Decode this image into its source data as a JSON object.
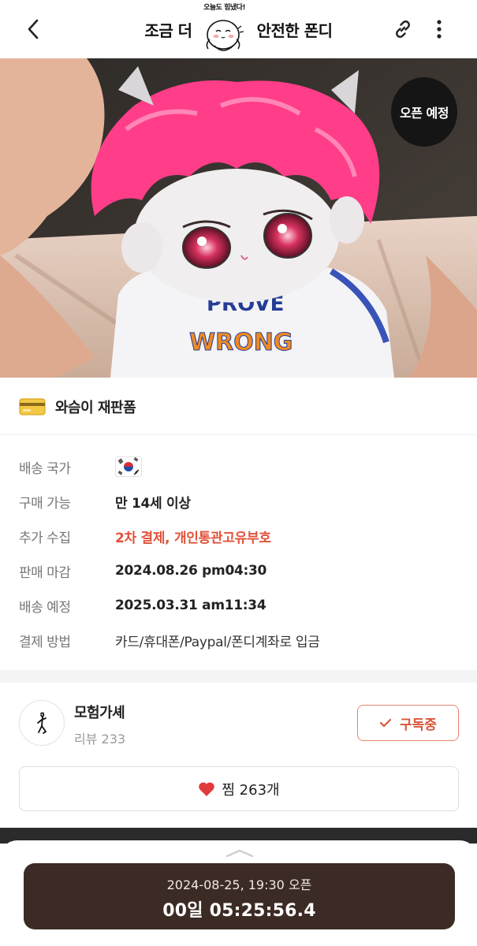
{
  "header": {
    "title_left": "조금 더",
    "title_right": "안전한 폰디",
    "mascot_caption": "오늘도 힘냈다!"
  },
  "hero": {
    "badge": "오픈 예정"
  },
  "product": {
    "name": "와슴이 재판폼"
  },
  "info": {
    "rows": [
      {
        "label": "배송 국가",
        "value": ""
      },
      {
        "label": "구매 가능",
        "value": "만 14세 이상"
      },
      {
        "label": "추가 수집",
        "value": "2차 결제, 개인통관고유부호"
      },
      {
        "label": "판매 마감",
        "value": "2024.08.26 pm04:30"
      },
      {
        "label": "배송 예정",
        "value": "2025.03.31 am11:34"
      },
      {
        "label": "결제 방법",
        "value": "카드/휴대폰/Paypal/폰디계좌로 입금"
      }
    ]
  },
  "seller": {
    "name": "모험가셰",
    "reviews": "리뷰 233",
    "subscribe_label": "구독중",
    "like_label": "찜 263개"
  },
  "sheet": {
    "open_time": "2024-08-25, 19:30 오픈",
    "countdown": "00일 05:25:56.4"
  },
  "colors": {
    "accent": "#d9553b",
    "countdown_bg": "#3b2b24",
    "heart": "#e23b3b"
  }
}
